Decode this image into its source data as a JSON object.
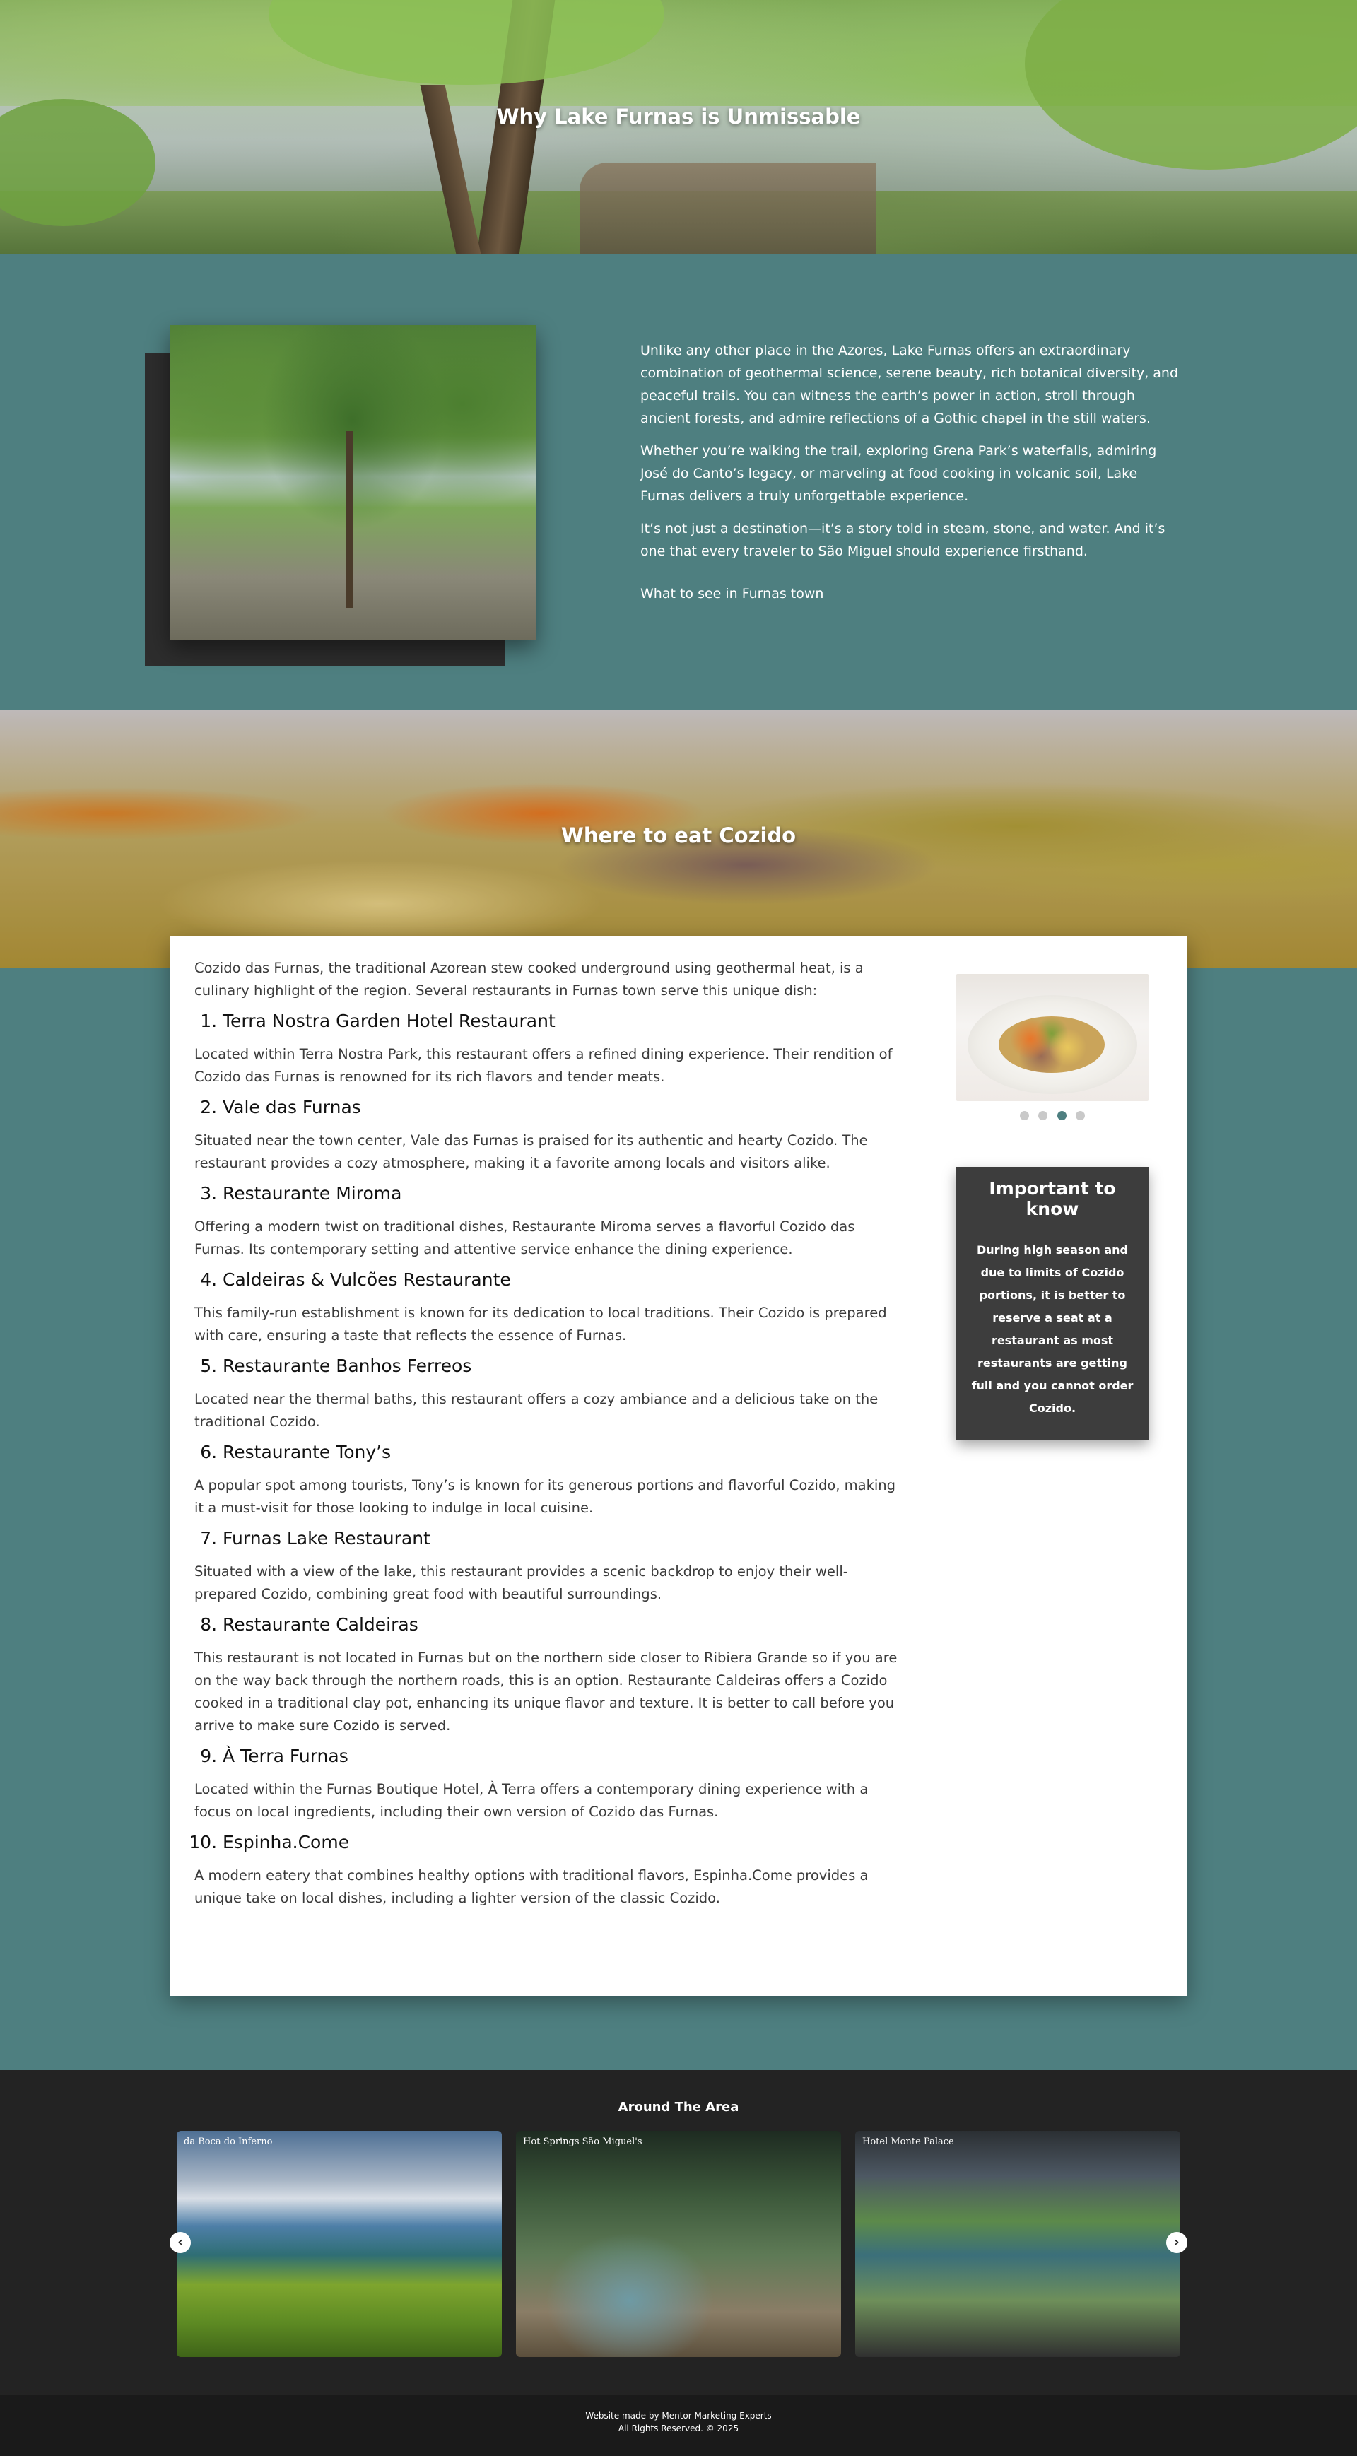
{
  "hero1": {
    "title": "Why Lake Furnas is Unmissable"
  },
  "intro": {
    "paragraphs": [
      "Unlike any other place in the Azores, Lake Furnas offers an extraordinary combination of geothermal science, serene beauty, rich botanical diversity, and peaceful trails. You can witness the earth’s power in action, stroll through ancient forests, and admire reflections of a Gothic chapel in the still waters.",
      "Whether you’re walking the trail, exploring Grena Park’s waterfalls, admiring José do Canto’s legacy, or marveling at food cooking in volcanic soil, Lake Furnas delivers a truly unforgettable experience.",
      "It’s not just a destination—it’s a story told in steam, stone, and water. And it’s one that every traveler to São Miguel should experience firsthand."
    ],
    "link": "What to see in Furnas town"
  },
  "hero2": {
    "title": "Where to eat Cozido"
  },
  "article": {
    "lead": "Cozido das Furnas, the traditional Azorean stew cooked underground using geothermal heat, is a culinary highlight of the region. Several restaurants in Furnas town serve this unique dish:",
    "restaurants": [
      {
        "name": "Terra Nostra Garden Hotel Restaurant",
        "desc": "Located within Terra Nostra Park, this restaurant offers a refined dining experience. Their rendition of Cozido das Furnas is renowned for its rich flavors and tender meats."
      },
      {
        "name": "Vale das Furnas",
        "desc": "Situated near the town center, Vale das Furnas is praised for its authentic and hearty Cozido. The restaurant provides a cozy atmosphere, making it a favorite among locals and visitors alike."
      },
      {
        "name": "Restaurante Miroma",
        "desc": "Offering a modern twist on traditional dishes, Restaurante Miroma serves a flavorful Cozido das Furnas. Its contemporary setting and attentive service enhance the dining experience."
      },
      {
        "name": "Caldeiras & Vulcões Restaurante",
        "desc": "This family-run establishment is known for its dedication to local traditions. Their Cozido is prepared with care, ensuring a taste that reflects the essence of Furnas."
      },
      {
        "name": "Restaurante Banhos Ferreos",
        "desc": "Located near the thermal baths, this restaurant offers a cozy ambiance and a delicious take on the traditional Cozido."
      },
      {
        "name": "Restaurante Tony’s",
        "desc": "A popular spot among tourists, Tony’s is known for its generous portions and flavorful Cozido, making it a must-visit for those looking to indulge in local cuisine."
      },
      {
        "name": "Furnas Lake Restaurant",
        "desc": "Situated with a view of the lake, this restaurant provides a scenic backdrop to enjoy their well-prepared Cozido, combining great food with beautiful surroundings."
      },
      {
        "name": "Restaurante Caldeiras",
        "desc": "This restaurant is not located in Furnas but on the northern side closer to Ribiera Grande so if you are on the way back through the northern roads, this is an option. Restaurante Caldeiras offers a Cozido cooked in a traditional clay pot, enhancing its unique flavor and texture. It is better to call before you arrive to make sure Cozido is served."
      },
      {
        "name": "À Terra Furnas",
        "desc": "Located within the Furnas Boutique Hotel, À Terra offers a contemporary dining experience with a focus on local ingredients, including their own version of Cozido das Furnas."
      },
      {
        "name": "Espinha.Come",
        "desc": "A modern eatery that combines healthy options with traditional flavors, Espinha.Come provides a unique take on local dishes, including a lighter version of the classic Cozido."
      }
    ]
  },
  "sidebar": {
    "slider_dots": 4,
    "active_dot": 3,
    "note_title": "Important to know",
    "note_text": "During high season and due to limits of Cozido portions, it is better to reserve a seat at a restaurant as most restaurants are getting full and you cannot order Cozido."
  },
  "around": {
    "title": "Around The Area",
    "tiles": [
      "da Boca do Inferno",
      "Hot Springs São Miguel's",
      "Hotel Monte Palace"
    ]
  },
  "footer": {
    "line1": "Website made by Mentor Marketing Experts",
    "line2": "All Rights Reserved. © 2025"
  }
}
